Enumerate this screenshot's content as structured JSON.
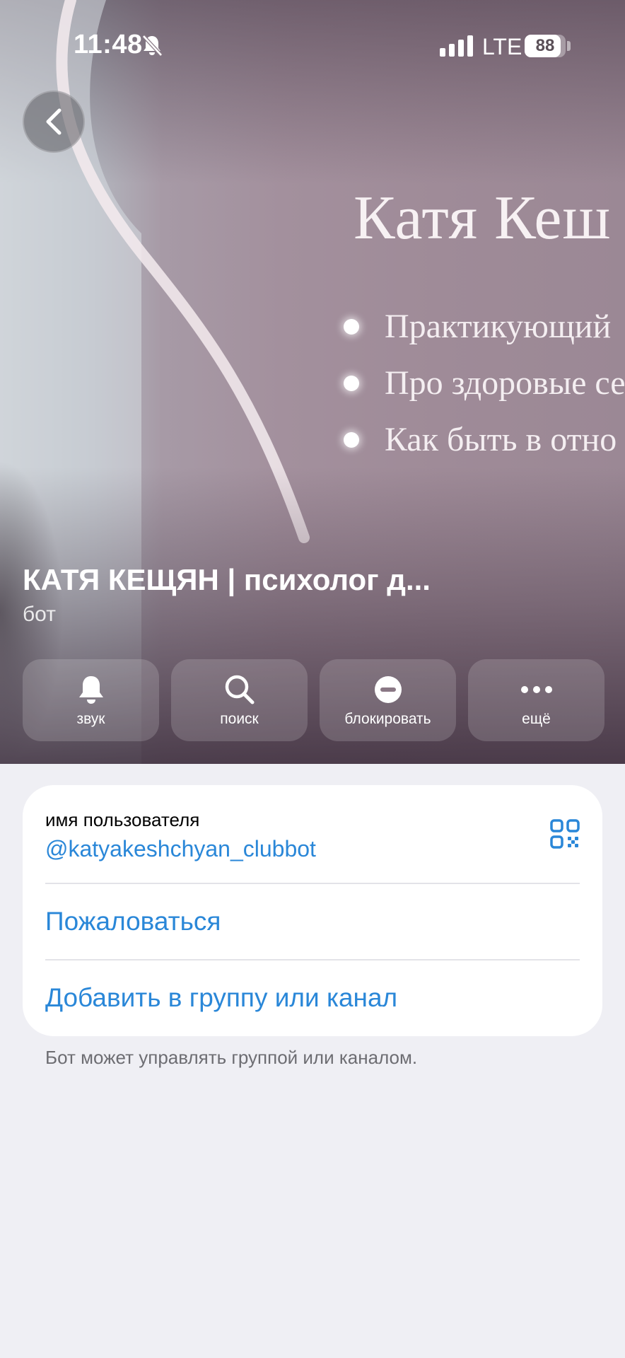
{
  "status_bar": {
    "time": "11:48",
    "network": "LTE",
    "battery": "88",
    "battery_level": 0.88,
    "icons": [
      "bell-off-icon",
      "signal-icon",
      "battery-icon"
    ]
  },
  "cover": {
    "title": "Катя Кеш",
    "bullets": [
      "Практикующий",
      "Про здоровые се",
      "Как быть в отно"
    ]
  },
  "profile": {
    "name": "КАТЯ КЕЩЯН | психолог д...",
    "type": "бот"
  },
  "actions": [
    {
      "label": "звук",
      "icon": "bell-icon"
    },
    {
      "label": "поиск",
      "icon": "search-icon"
    },
    {
      "label": "блокировать",
      "icon": "block-icon"
    },
    {
      "label": "ещё",
      "icon": "more-icon"
    }
  ],
  "info": {
    "username_label": "имя пользователя",
    "username": "@katyakeshchyan_clubbot",
    "report": "Пожаловаться",
    "add_to_group": "Добавить в группу или канал",
    "footnote": "Бот может управлять группой или каналом."
  },
  "colors": {
    "accent": "#2a87d8",
    "background": "#efeff4"
  }
}
